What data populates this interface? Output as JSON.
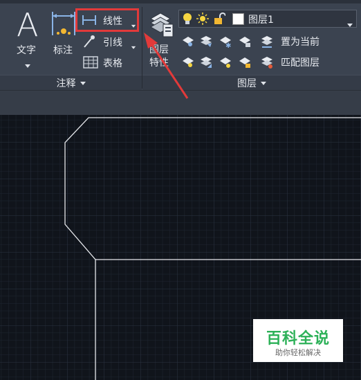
{
  "annotation_panel": {
    "text_label": "文字",
    "dimension_label": "标注",
    "linear_label": "线性",
    "leader_label": "引线",
    "table_label": "表格",
    "footer_label": "注释"
  },
  "layers_panel": {
    "layer_properties_label_line1": "图层",
    "layer_properties_label_line2": "特性",
    "current_layer": "图层1",
    "make_current_label": "置为当前",
    "match_layer_label": "匹配图层",
    "footer_label": "图层"
  },
  "watermark": {
    "title": "百科全说",
    "subtitle": "助你轻松解决"
  },
  "colors": {
    "ribbon_bg": "#3b4350",
    "canvas_bg": "#10141b",
    "highlight_red": "#e23a3a",
    "brand_green": "#2db158"
  }
}
